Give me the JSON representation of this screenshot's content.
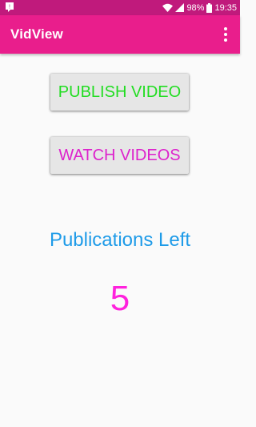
{
  "status_bar": {
    "battery": "98%",
    "time": "19:35",
    "icons": [
      "notification-icon",
      "wifi-icon",
      "signal-icon",
      "battery-icon"
    ]
  },
  "app_bar": {
    "title": "VidView",
    "menu_icon": "more-vert-icon"
  },
  "main": {
    "publish_label": "PUBLISH VIDEO",
    "watch_label": "WATCH VIDEOS",
    "publications_label": "Publications Left",
    "publications_count": "5"
  },
  "colors": {
    "status_bar": "#c01a7c",
    "app_bar": "#e91e8c",
    "publish_text": "#22dd22",
    "watch_text": "#dd22cc",
    "label_text": "#1e9be8",
    "count_text": "#ff22dd"
  }
}
